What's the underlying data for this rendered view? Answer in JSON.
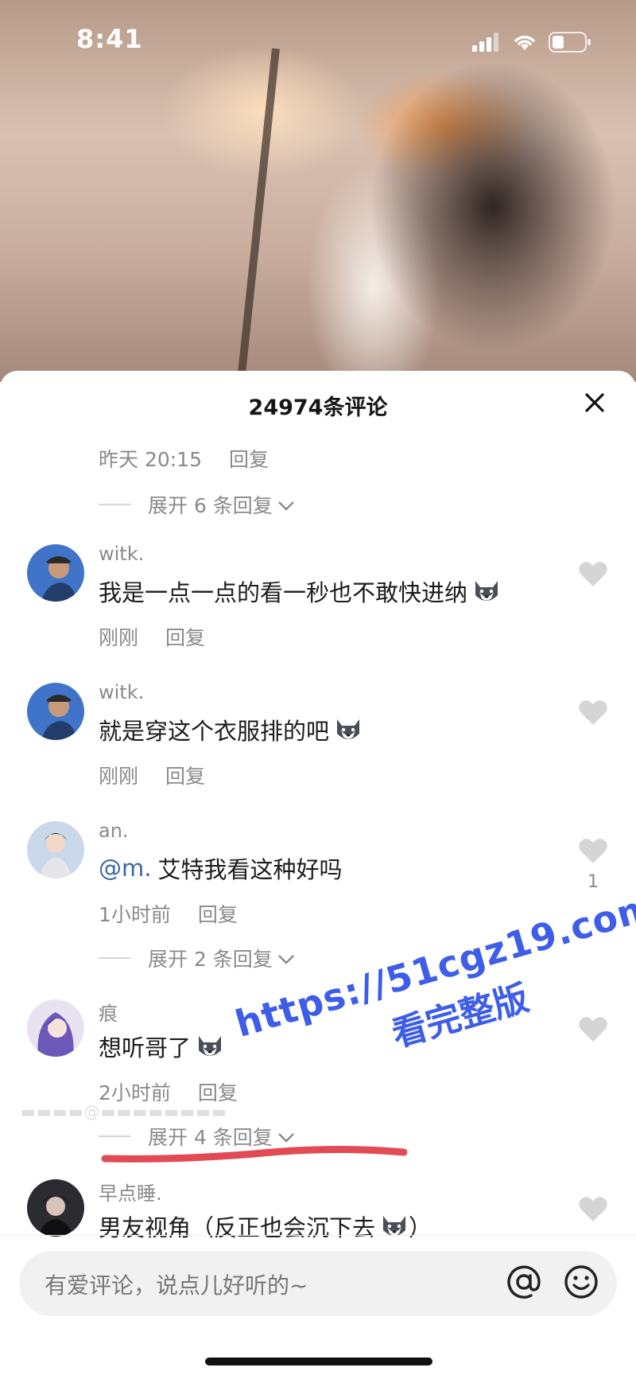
{
  "status": {
    "time": "8:41"
  },
  "sheet": {
    "title": "24974条评论"
  },
  "top_meta": {
    "time": "昨天 20:15",
    "reply": "回复"
  },
  "expand_1": {
    "label": "展开 6 条回复"
  },
  "comments": [
    {
      "user": "witk.",
      "text": "我是一点一点的看一秒也不敢快进纳",
      "time": "刚刚",
      "reply": "回复",
      "likes": ""
    },
    {
      "user": "witk.",
      "text": "就是穿这个衣服排的吧",
      "time": "刚刚",
      "reply": "回复",
      "likes": ""
    },
    {
      "user": "an.",
      "mention": "@m.",
      "text": "艾特我看这种好吗",
      "time": "1小时前",
      "reply": "回复",
      "likes": "1"
    },
    {
      "user": "痕",
      "text": "想听哥了",
      "time": "2小时前",
      "reply": "回复",
      "likes": ""
    },
    {
      "user": "早点睡.",
      "text": "男友视角（反正也会沉下去",
      "text_end": "）",
      "likes": ""
    }
  ],
  "expand_2": {
    "label": "展开 2 条回复"
  },
  "expand_3": {
    "label": "展开 4 条回复"
  },
  "watermark": {
    "url": "https://51cgz19.com",
    "label": "看完整版"
  },
  "input": {
    "placeholder": "有爱评论，说点儿好听的~"
  },
  "icons": [
    "signal-icon",
    "wifi-icon",
    "battery-icon",
    "close-icon",
    "heart-icon",
    "at-icon",
    "emoji-icon",
    "husky-emoji-icon"
  ]
}
